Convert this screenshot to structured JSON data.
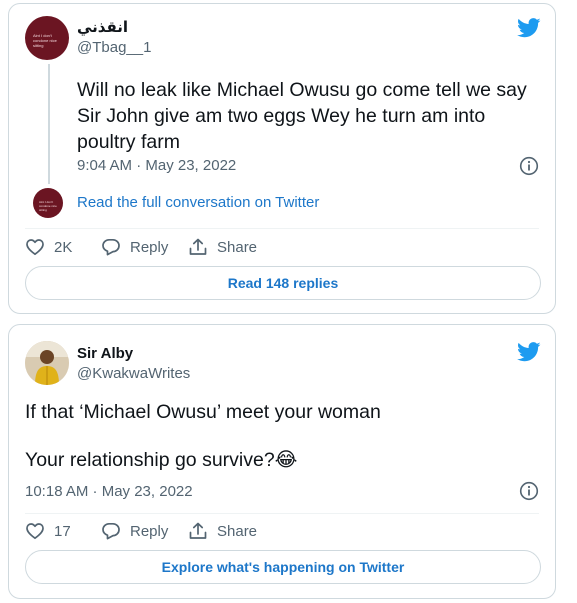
{
  "colors": {
    "accent": "#1d77c9",
    "twitter_blue": "#1d9bf0",
    "border": "#cfd9de",
    "secondary_text": "#536471"
  },
  "tweet1": {
    "display_name": "انقذني",
    "handle": "@Tbag__1",
    "avatar_text": "Aint I don't condone nice sitting",
    "text_lines": [
      "Will no leak like Michael Owusu go come tell we say",
      "Sir John give am two eggs Wey he turn am into",
      "poultry farm"
    ],
    "timestamp": "9:04 AM · May 23, 2022",
    "conversation_link": "Read the full conversation on Twitter",
    "like_count": "2K",
    "reply_label": "Reply",
    "share_label": "Share",
    "pill_label": "Read 148 replies",
    "icons": [
      "twitter-logo-icon",
      "info-icon",
      "heart-icon",
      "reply-icon",
      "share-icon"
    ]
  },
  "tweet2": {
    "display_name": "Sir Alby",
    "handle": "@KwakwaWrites",
    "text_line1": "If that ‘Michael Owusu’ meet your woman",
    "text_line2": "Your relationship go survive?😂",
    "timestamp": "10:18 AM · May 23, 2022",
    "like_count": "17",
    "reply_label": "Reply",
    "share_label": "Share",
    "pill_label": "Explore what's happening on Twitter",
    "icons": [
      "twitter-logo-icon",
      "info-icon",
      "heart-icon",
      "reply-icon",
      "share-icon"
    ]
  }
}
